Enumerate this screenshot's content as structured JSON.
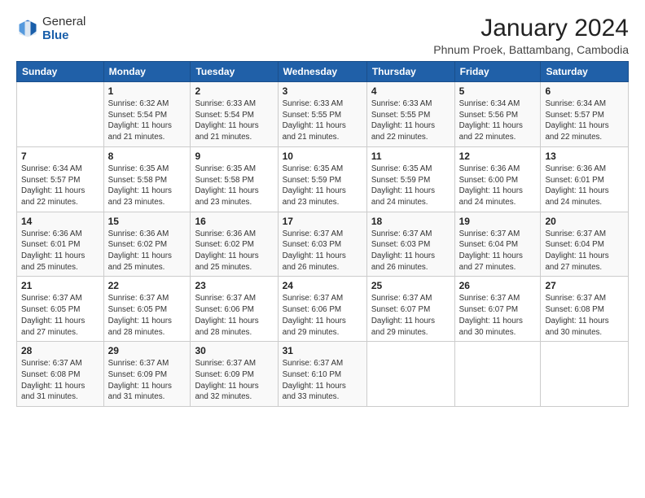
{
  "header": {
    "logo_general": "General",
    "logo_blue": "Blue",
    "month_title": "January 2024",
    "location": "Phnum Proek, Battambang, Cambodia"
  },
  "days_of_week": [
    "Sunday",
    "Monday",
    "Tuesday",
    "Wednesday",
    "Thursday",
    "Friday",
    "Saturday"
  ],
  "weeks": [
    [
      {
        "day": "",
        "info": ""
      },
      {
        "day": "1",
        "info": "Sunrise: 6:32 AM\nSunset: 5:54 PM\nDaylight: 11 hours\nand 21 minutes."
      },
      {
        "day": "2",
        "info": "Sunrise: 6:33 AM\nSunset: 5:54 PM\nDaylight: 11 hours\nand 21 minutes."
      },
      {
        "day": "3",
        "info": "Sunrise: 6:33 AM\nSunset: 5:55 PM\nDaylight: 11 hours\nand 21 minutes."
      },
      {
        "day": "4",
        "info": "Sunrise: 6:33 AM\nSunset: 5:55 PM\nDaylight: 11 hours\nand 22 minutes."
      },
      {
        "day": "5",
        "info": "Sunrise: 6:34 AM\nSunset: 5:56 PM\nDaylight: 11 hours\nand 22 minutes."
      },
      {
        "day": "6",
        "info": "Sunrise: 6:34 AM\nSunset: 5:57 PM\nDaylight: 11 hours\nand 22 minutes."
      }
    ],
    [
      {
        "day": "7",
        "info": "Sunrise: 6:34 AM\nSunset: 5:57 PM\nDaylight: 11 hours\nand 22 minutes."
      },
      {
        "day": "8",
        "info": "Sunrise: 6:35 AM\nSunset: 5:58 PM\nDaylight: 11 hours\nand 23 minutes."
      },
      {
        "day": "9",
        "info": "Sunrise: 6:35 AM\nSunset: 5:58 PM\nDaylight: 11 hours\nand 23 minutes."
      },
      {
        "day": "10",
        "info": "Sunrise: 6:35 AM\nSunset: 5:59 PM\nDaylight: 11 hours\nand 23 minutes."
      },
      {
        "day": "11",
        "info": "Sunrise: 6:35 AM\nSunset: 5:59 PM\nDaylight: 11 hours\nand 24 minutes."
      },
      {
        "day": "12",
        "info": "Sunrise: 6:36 AM\nSunset: 6:00 PM\nDaylight: 11 hours\nand 24 minutes."
      },
      {
        "day": "13",
        "info": "Sunrise: 6:36 AM\nSunset: 6:01 PM\nDaylight: 11 hours\nand 24 minutes."
      }
    ],
    [
      {
        "day": "14",
        "info": "Sunrise: 6:36 AM\nSunset: 6:01 PM\nDaylight: 11 hours\nand 25 minutes."
      },
      {
        "day": "15",
        "info": "Sunrise: 6:36 AM\nSunset: 6:02 PM\nDaylight: 11 hours\nand 25 minutes."
      },
      {
        "day": "16",
        "info": "Sunrise: 6:36 AM\nSunset: 6:02 PM\nDaylight: 11 hours\nand 25 minutes."
      },
      {
        "day": "17",
        "info": "Sunrise: 6:37 AM\nSunset: 6:03 PM\nDaylight: 11 hours\nand 26 minutes."
      },
      {
        "day": "18",
        "info": "Sunrise: 6:37 AM\nSunset: 6:03 PM\nDaylight: 11 hours\nand 26 minutes."
      },
      {
        "day": "19",
        "info": "Sunrise: 6:37 AM\nSunset: 6:04 PM\nDaylight: 11 hours\nand 27 minutes."
      },
      {
        "day": "20",
        "info": "Sunrise: 6:37 AM\nSunset: 6:04 PM\nDaylight: 11 hours\nand 27 minutes."
      }
    ],
    [
      {
        "day": "21",
        "info": "Sunrise: 6:37 AM\nSunset: 6:05 PM\nDaylight: 11 hours\nand 27 minutes."
      },
      {
        "day": "22",
        "info": "Sunrise: 6:37 AM\nSunset: 6:05 PM\nDaylight: 11 hours\nand 28 minutes."
      },
      {
        "day": "23",
        "info": "Sunrise: 6:37 AM\nSunset: 6:06 PM\nDaylight: 11 hours\nand 28 minutes."
      },
      {
        "day": "24",
        "info": "Sunrise: 6:37 AM\nSunset: 6:06 PM\nDaylight: 11 hours\nand 29 minutes."
      },
      {
        "day": "25",
        "info": "Sunrise: 6:37 AM\nSunset: 6:07 PM\nDaylight: 11 hours\nand 29 minutes."
      },
      {
        "day": "26",
        "info": "Sunrise: 6:37 AM\nSunset: 6:07 PM\nDaylight: 11 hours\nand 30 minutes."
      },
      {
        "day": "27",
        "info": "Sunrise: 6:37 AM\nSunset: 6:08 PM\nDaylight: 11 hours\nand 30 minutes."
      }
    ],
    [
      {
        "day": "28",
        "info": "Sunrise: 6:37 AM\nSunset: 6:08 PM\nDaylight: 11 hours\nand 31 minutes."
      },
      {
        "day": "29",
        "info": "Sunrise: 6:37 AM\nSunset: 6:09 PM\nDaylight: 11 hours\nand 31 minutes."
      },
      {
        "day": "30",
        "info": "Sunrise: 6:37 AM\nSunset: 6:09 PM\nDaylight: 11 hours\nand 32 minutes."
      },
      {
        "day": "31",
        "info": "Sunrise: 6:37 AM\nSunset: 6:10 PM\nDaylight: 11 hours\nand 33 minutes."
      },
      {
        "day": "",
        "info": ""
      },
      {
        "day": "",
        "info": ""
      },
      {
        "day": "",
        "info": ""
      }
    ]
  ]
}
